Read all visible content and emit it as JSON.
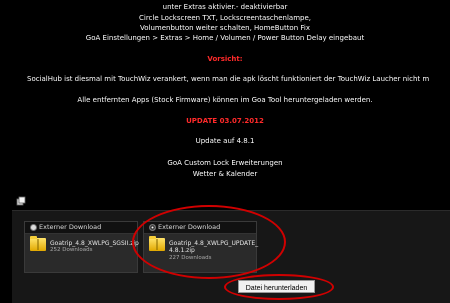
{
  "post_lines": [
    "unter Extras aktivier.- deaktivierbar",
    "Circle Lockscreen TXT, Lockscreentaschenlampe,",
    "Volumenbutton weiter schalten, HomeButton Fix",
    "GoA Einstellungen > Extras > Home / Volumen / Power Button Delay eingebaut",
    "Vorsicht:",
    "SocialHub ist diesmal mit TouchWiz verankert, wenn man die apk löscht funktioniert der TouchWiz Laucher nicht m",
    "Alle entfernten Apps (Stock Firmware) können im Goa Tool heruntergeladen werden.",
    "UPDATE 03.07.2012",
    "Update auf 4.8.1",
    "GoA Custom Lock Erweiterungen",
    "Wetter & Kalender"
  ],
  "attachments": [
    {
      "option_label": "Externer Download",
      "selected": false,
      "file_name": "Goatrip_4.8_XWLPG_SGSII.zip",
      "downloads": "252 Downloads",
      "icon": "folder-zip-icon"
    },
    {
      "option_label": "Externer Download",
      "selected": true,
      "file_name_line1": "Goatrip_4.8_XWLPG_UPDATE_",
      "file_name_line2": "4.8.1.zip",
      "downloads": "227 Downloads",
      "icon": "folder-zip-icon"
    }
  ],
  "download_button": "Datei herunterladen",
  "colors": {
    "background": "#000000",
    "warning_red": "#ff2a2a",
    "annotation_red": "#d10000",
    "panel": "#171717"
  }
}
